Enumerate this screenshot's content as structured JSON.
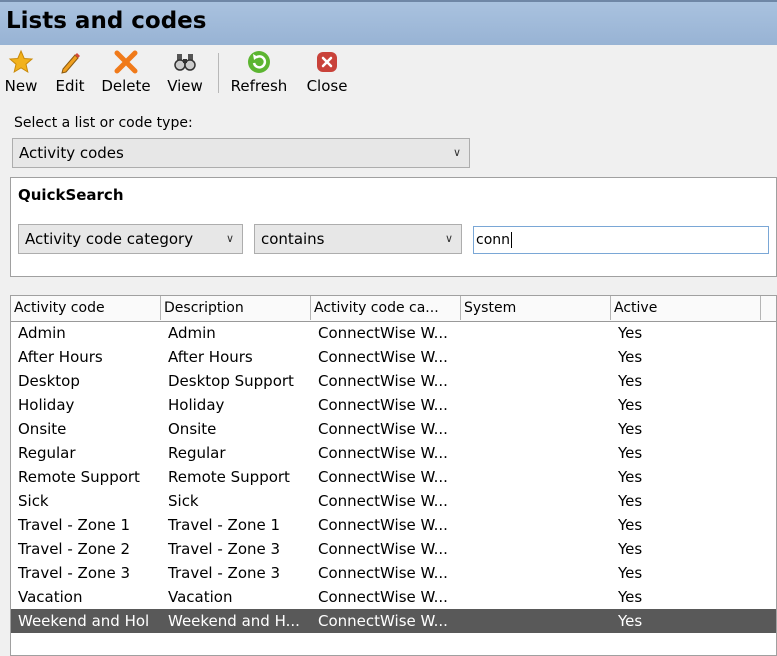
{
  "window": {
    "title": "Lists and codes"
  },
  "toolbar": {
    "new_label": "New",
    "edit_label": "Edit",
    "delete_label": "Delete",
    "view_label": "View",
    "refresh_label": "Refresh",
    "close_label": "Close"
  },
  "selector": {
    "label": "Select a list or code type:",
    "value": "Activity codes"
  },
  "quicksearch": {
    "title": "QuickSearch",
    "field": "Activity code category",
    "operator": "contains",
    "value": "conn"
  },
  "table": {
    "columns": [
      "Activity code",
      "Description",
      "Activity code ca...",
      "System",
      "Active"
    ],
    "rows": [
      [
        "Admin",
        "Admin",
        "ConnectWise W...",
        "",
        "Yes"
      ],
      [
        "After Hours",
        "After Hours",
        "ConnectWise W...",
        "",
        "Yes"
      ],
      [
        "Desktop",
        "Desktop Support",
        "ConnectWise W...",
        "",
        "Yes"
      ],
      [
        "Holiday",
        "Holiday",
        "ConnectWise W...",
        "",
        "Yes"
      ],
      [
        "Onsite",
        "Onsite",
        "ConnectWise W...",
        "",
        "Yes"
      ],
      [
        "Regular",
        "Regular",
        "ConnectWise W...",
        "",
        "Yes"
      ],
      [
        "Remote Support",
        "Remote Support",
        "ConnectWise W...",
        "",
        "Yes"
      ],
      [
        "Sick",
        "Sick",
        "ConnectWise W...",
        "",
        "Yes"
      ],
      [
        "Travel - Zone 1",
        "Travel - Zone 1",
        "ConnectWise W...",
        "",
        "Yes"
      ],
      [
        "Travel - Zone 2",
        "Travel - Zone 3",
        "ConnectWise W...",
        "",
        "Yes"
      ],
      [
        "Travel - Zone 3",
        "Travel - Zone 3",
        "ConnectWise W...",
        "",
        "Yes"
      ],
      [
        "Vacation",
        "Vacation",
        "ConnectWise W...",
        "",
        "Yes"
      ],
      [
        "Weekend and Hol",
        "Weekend and H...",
        "ConnectWise W...",
        "",
        "Yes"
      ]
    ],
    "selected_row": 12
  },
  "colors": {
    "titlebar": "#a9c2df",
    "selected_row": "#595959",
    "star": "#f2b21c",
    "delete": "#f07a1a",
    "refresh": "#5cb531",
    "close": "#c9423a"
  }
}
